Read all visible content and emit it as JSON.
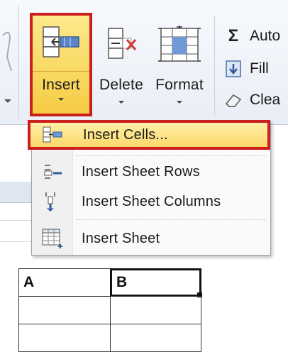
{
  "ribbon": {
    "buttons": {
      "insert": {
        "label": "Insert"
      },
      "delete": {
        "label": "Delete"
      },
      "format": {
        "label": "Format"
      }
    },
    "editing": {
      "autosum": {
        "label": "Auto",
        "icon": "sigma-icon"
      },
      "fill": {
        "label": "Fill",
        "icon": "fill-down-icon"
      },
      "clear": {
        "label": "Clea",
        "icon": "eraser-icon"
      }
    }
  },
  "insert_menu": {
    "items": [
      {
        "label": "Insert Cells...",
        "icon": "insert-cells-icon",
        "highlighted": true
      },
      {
        "label": "Insert Sheet Rows",
        "icon": "insert-rows-icon"
      },
      {
        "label": "Insert Sheet Columns",
        "icon": "insert-columns-icon"
      },
      {
        "label": "Insert Sheet",
        "icon": "insert-sheet-icon"
      }
    ]
  },
  "sheet": {
    "cells": [
      {
        "ref": "A",
        "value": "A"
      },
      {
        "ref": "B",
        "value": "B",
        "selected": true
      }
    ]
  },
  "colors": {
    "highlight_border": "#cc1f1f",
    "highlight_fill": "#f6cc45",
    "ribbon_bg": "#e9eef6"
  }
}
